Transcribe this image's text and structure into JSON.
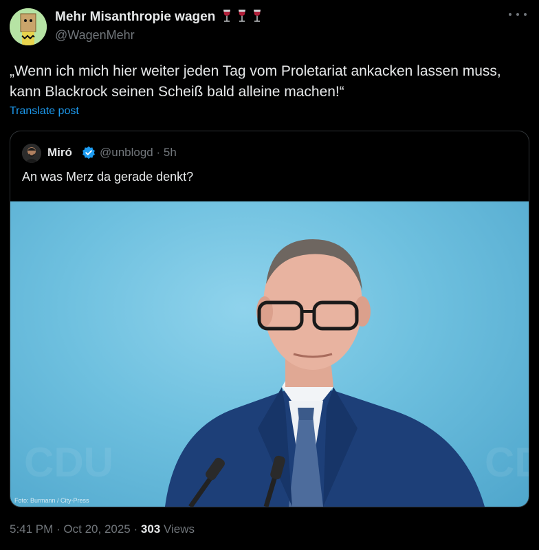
{
  "author": {
    "display_name": "Mehr Misanthropie wagen",
    "handle": "@WagenMehr",
    "name_emoji": "wine-glass-icon x3"
  },
  "post": {
    "text": "„Wenn ich mich hier weiter jeden Tag vom Proletariat ankacken lassen muss, kann Blackrock seinen Scheiß bald alleine machen!“",
    "translate_label": "Translate post"
  },
  "quote": {
    "name": "Miró",
    "handle_time": "@unblogd · 5h",
    "text": "An was Merz da gerade denkt?",
    "image_credit": "Foto: Burmann / City-Press"
  },
  "footer": {
    "time_date": "5:41 PM · Oct 20, 2025 · ",
    "views_count": "303",
    "views_label": " Views"
  },
  "colors": {
    "background": "#000000",
    "text": "#e7e9ea",
    "secondary": "#71767b",
    "link": "#1d9bf0",
    "border": "#2f3336",
    "photo_bg": "#7ac8e6"
  }
}
